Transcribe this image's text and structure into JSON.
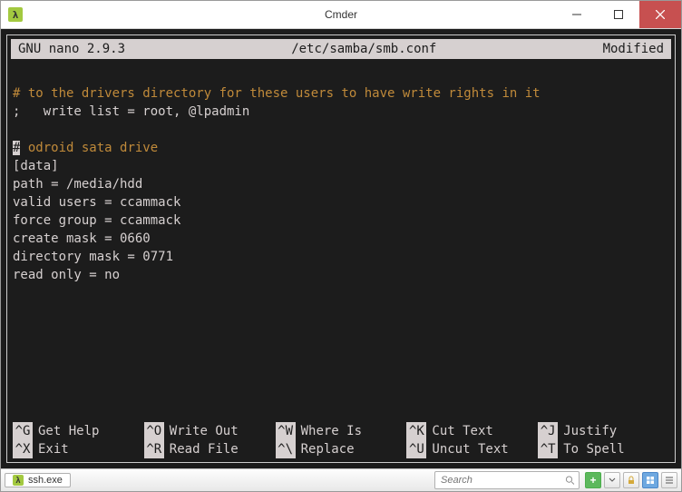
{
  "window": {
    "title": "Cmder",
    "icon_glyph": "λ"
  },
  "nano_header": {
    "left": "GNU nano 2.9.3",
    "center": "/etc/samba/smb.conf",
    "right": "Modified"
  },
  "content": {
    "line1": "# to the drivers directory for these users to have write rights in it",
    "line2": ";   write list = root, @lpadmin",
    "blank": "",
    "cursor": "#",
    "line4": " odroid sata drive",
    "line5": "[data]",
    "line6": "path = /media/hdd",
    "line7": "valid users = ccammack",
    "line8": "force group = ccammack",
    "line9": "create mask = 0660",
    "line10": "directory mask = 0771",
    "line11": "read only = no"
  },
  "menu": {
    "row1": [
      {
        "key": "^G",
        "label": "Get Help"
      },
      {
        "key": "^O",
        "label": "Write Out"
      },
      {
        "key": "^W",
        "label": "Where Is"
      },
      {
        "key": "^K",
        "label": "Cut Text"
      },
      {
        "key": "^J",
        "label": "Justify"
      }
    ],
    "row2": [
      {
        "key": "^X",
        "label": "Exit"
      },
      {
        "key": "^R",
        "label": "Read File"
      },
      {
        "key": "^\\",
        "label": "Replace"
      },
      {
        "key": "^U",
        "label": "Uncut Text"
      },
      {
        "key": "^T",
        "label": "To Spell"
      }
    ]
  },
  "status": {
    "tab_icon": "λ",
    "tab_label": "ssh.exe",
    "search_placeholder": "Search"
  }
}
